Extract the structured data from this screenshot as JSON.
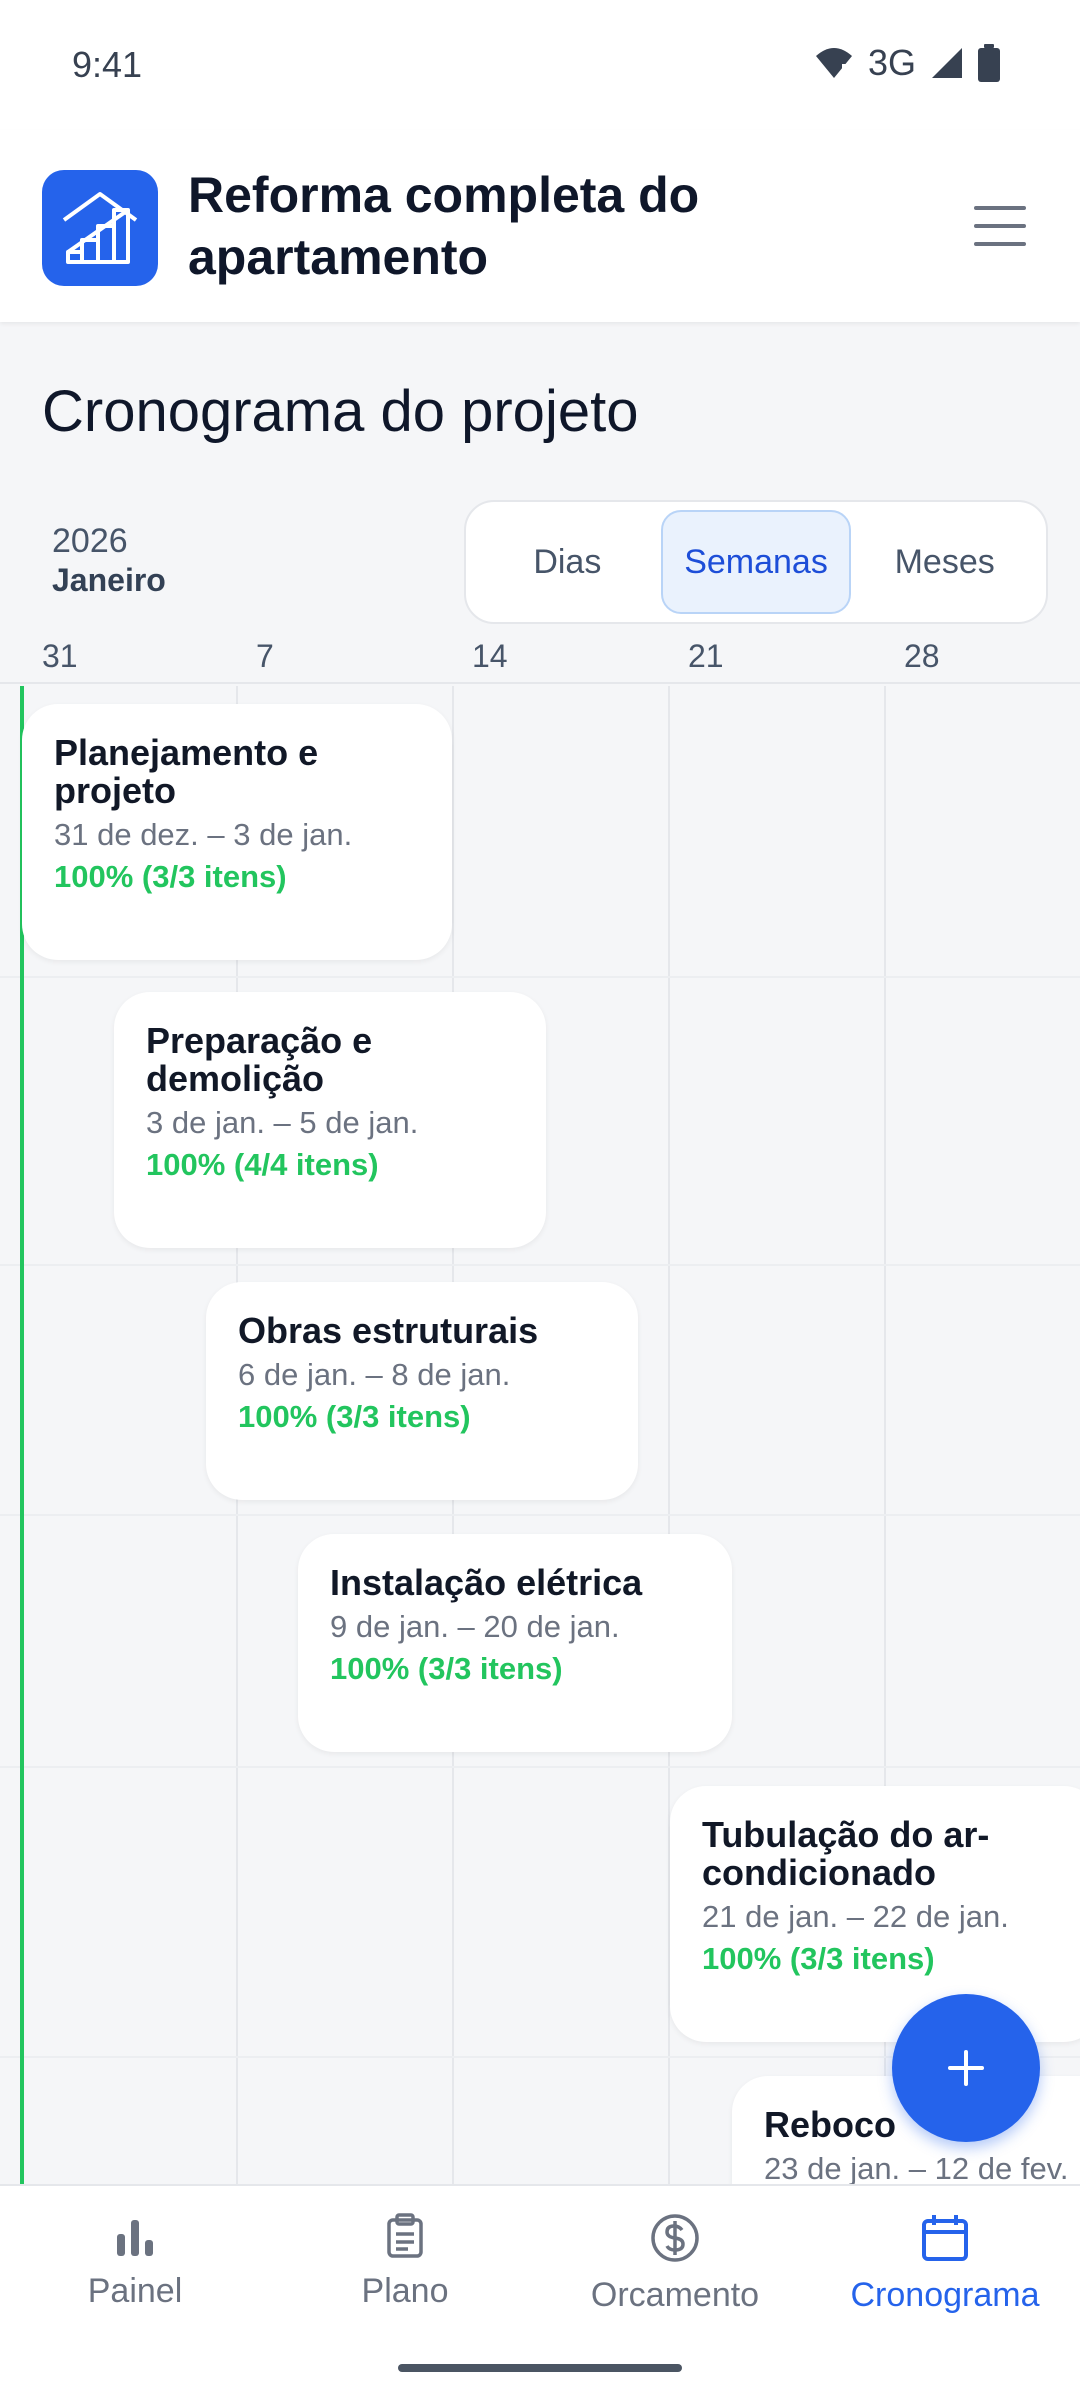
{
  "status_bar": {
    "time": "9:41",
    "network": "3G"
  },
  "header": {
    "title": "Reforma completa do apartamento",
    "logo_icon": "building-stairs-icon",
    "menu_icon": "hamburger-menu-icon"
  },
  "page": {
    "title": "Cronograma do projeto"
  },
  "timeline": {
    "year": "2026",
    "month": "Janeiro",
    "views": [
      "Dias",
      "Semanas",
      "Meses"
    ],
    "active_view": "Semanas",
    "ticks": [
      "31",
      "7",
      "14",
      "21",
      "28"
    ]
  },
  "tasks": [
    {
      "name": "Planejamento e projeto",
      "dates": "31 de dez. – 3 de jan.",
      "progress": "100% (3/3 itens)"
    },
    {
      "name": "Preparação e demolição",
      "dates": "3 de jan. – 5 de jan.",
      "progress": "100% (4/4 itens)"
    },
    {
      "name": "Obras estruturais",
      "dates": "6 de jan. – 8 de jan.",
      "progress": "100% (3/3 itens)"
    },
    {
      "name": "Instalação elétrica",
      "dates": "9 de jan. – 20 de jan.",
      "progress": "100% (3/3 itens)"
    },
    {
      "name": "Tubulação do ar-condicionado",
      "dates": "21 de jan. – 22 de jan.",
      "progress": "100% (3/3 itens)"
    },
    {
      "name": "Reboco",
      "dates": "23 de jan. – 12 de fev.",
      "progress": ""
    }
  ],
  "fab": {
    "icon": "plus-icon"
  },
  "nav": [
    {
      "label": "Painel",
      "icon": "bar-chart-icon"
    },
    {
      "label": "Plano",
      "icon": "clipboard-icon"
    },
    {
      "label": "Orcamento",
      "icon": "dollar-circle-icon"
    },
    {
      "label": "Cronograma",
      "icon": "calendar-icon"
    }
  ],
  "colors": {
    "primary": "#2563eb",
    "success": "#22c55e",
    "text": "#0f172a",
    "muted": "#6b7280"
  }
}
